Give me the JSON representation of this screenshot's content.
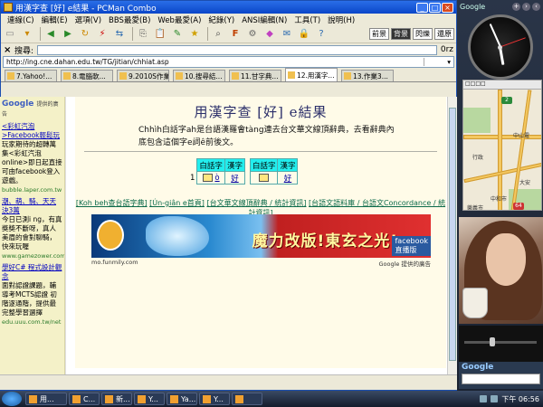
{
  "window": {
    "title": "用漢字查 [好] e結果 - PCMan Combo"
  },
  "menu": [
    "連線(C)",
    "編輯(E)",
    "選項(V)",
    "BBS最愛(B)",
    "Web最愛(A)",
    "紀錄(Y)",
    "ANSI編輯(N)",
    "工具(T)",
    "說明(H)"
  ],
  "toolbar": {
    "right_buttons": [
      "前景",
      "背景",
      "閃爍",
      "還原"
    ]
  },
  "search": {
    "placeholder": "搜尋:",
    "zoom": "0rz"
  },
  "url": "http://ing.cne.dahan.edu.tw/TG/jitian/chhiat.asp",
  "tabs": [
    {
      "label": "7.Yahoo!...",
      "active": false
    },
    {
      "label": "8.電腦軟...",
      "active": false
    },
    {
      "label": "9.2010S作業",
      "active": false
    },
    {
      "label": "10.搜尋結...",
      "active": false
    },
    {
      "label": "11.甘字典...",
      "active": false
    },
    {
      "label": "12.用漢字...",
      "active": true
    },
    {
      "label": "13.作業3...",
      "active": false
    }
  ],
  "sidebar": {
    "logo": "Google",
    "logo_sub": "提供的廣告",
    "ads": [
      {
        "title": "<彩虹汽泡>Facebook輕鬆玩",
        "body": "玩家期待的超轉萬集<彩虹汽泡online>即日起直接可由facebook登入遊戲。",
        "url": "bubble.laper.com.tw"
      },
      {
        "title": "潮、萌、騎、天天決3萬",
        "body": "今日已測i ng，有真獎獎不斷呀，真人美眉的會對聊騎，快來玩喔",
        "url": "www.gamezower.com.tw"
      },
      {
        "title": "學好C# 程式設計觀念",
        "body": "面對認證課題，輔導考MCTS認證 初階逐通階，提供最完整學習選擇",
        "url": "edu.uuu.com.tw/net"
      }
    ]
  },
  "page": {
    "title": "用漢字查 [好] e結果",
    "intro": "Chhìh白話字ah是台語漢羅會tàng連去台文華文線頂辭典，去看辭典內底包含這個字e詞ê前後文。",
    "table": {
      "headers": [
        "白話字",
        "漢字",
        "白話字",
        "漢字"
      ],
      "row_num": "1",
      "romaji": "ò",
      "hanzi": "好",
      "hanzi2": "好"
    },
    "links": [
      "[Koh beh查台語字典]",
      "[Ún-giân e首頁]",
      "[台文華文線頂辭典 / 統計資訊]",
      "[台語文語料庫 / 台語文Concordance / 統計資訊]"
    ],
    "banner_text": "魔力改版!東玄之光!",
    "banner_facebook": "facebook",
    "banner_facebook_sub": "直播版",
    "banner_left_caption": "mo.funmily.com",
    "banner_right_caption": "Google 提供的廣告"
  },
  "gadgets": {
    "header": "Google",
    "map_select": "□□□□",
    "map_labels": [
      "中山電",
      "行政",
      "大安",
      "中和市",
      "樂義市"
    ],
    "map_shields": [
      "2",
      "64"
    ],
    "search_label": "Google"
  },
  "taskbar": {
    "tasks": [
      "用...",
      "C...",
      "新...",
      "Y...",
      "Ya...",
      "Y...",
      ""
    ],
    "clock": "下午 06:56"
  }
}
